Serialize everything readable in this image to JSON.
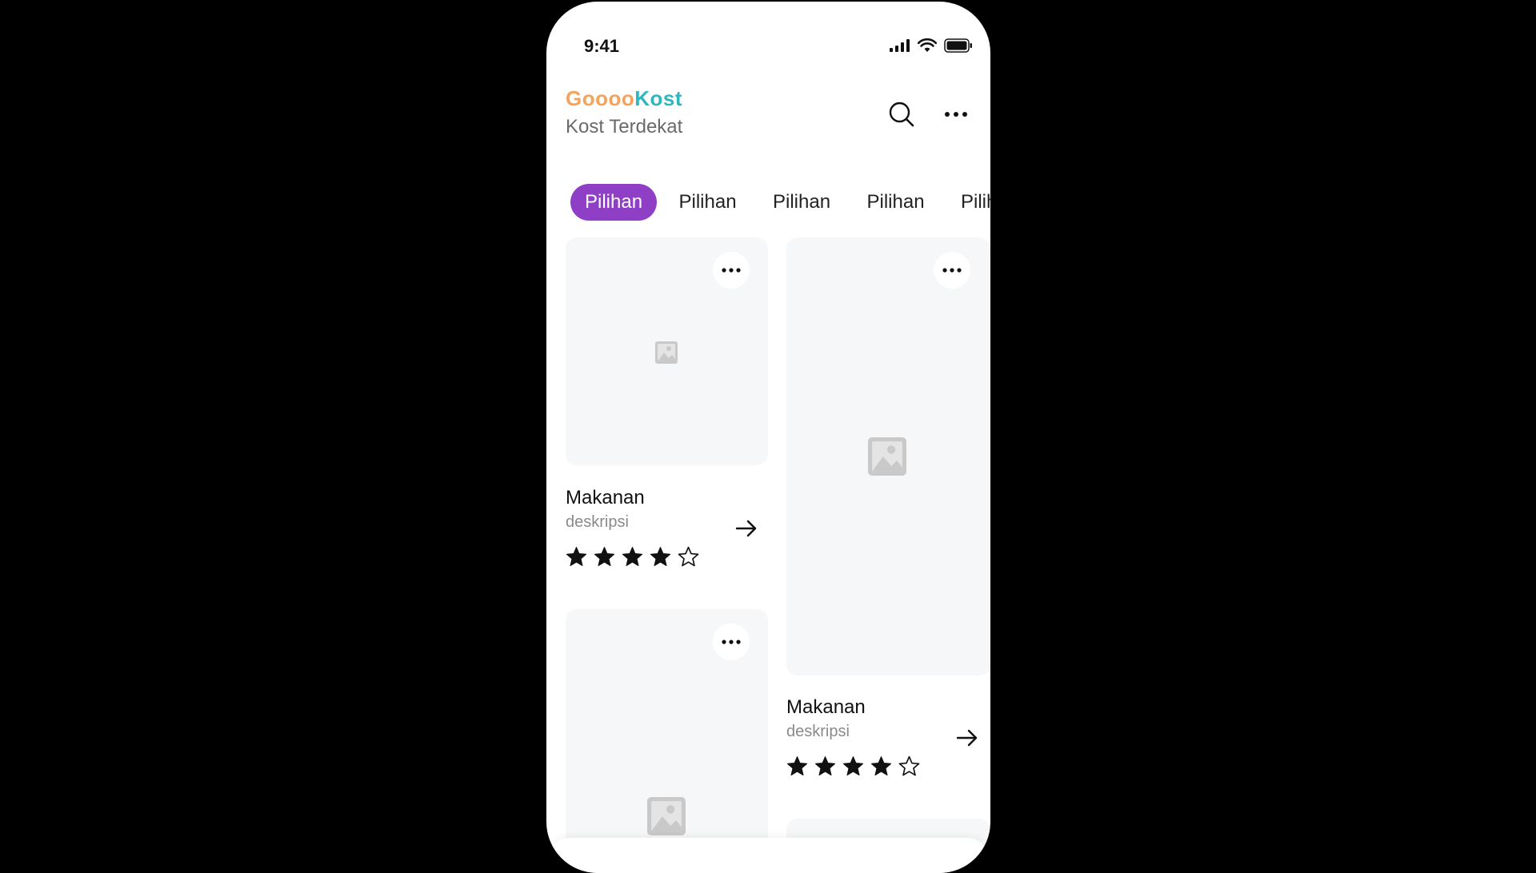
{
  "status_bar": {
    "time": "9:41"
  },
  "header": {
    "brand_part1": "Goooo",
    "brand_part2": "Kost",
    "subtitle": "Kost Terdekat",
    "search_icon": "search-icon",
    "more_icon": "more-horizontal-icon"
  },
  "chips": [
    {
      "label": "Pilihan",
      "active": true
    },
    {
      "label": "Pilihan",
      "active": false
    },
    {
      "label": "Pilihan",
      "active": false
    },
    {
      "label": "Pilihan",
      "active": false
    },
    {
      "label": "Pilihan",
      "active": false
    }
  ],
  "cards": [
    {
      "title": "Makanan",
      "description": "deskripsi",
      "rating": 4,
      "max_rating": 5
    },
    {
      "title": "Makanan",
      "description": "deskripsi",
      "rating": 4,
      "max_rating": 5
    },
    {
      "title": "",
      "description": "",
      "rating": 0,
      "max_rating": 5
    }
  ],
  "colors": {
    "brand_orange": "#f5a35c",
    "brand_teal": "#2fb6bf",
    "chip_active": "#8e3fc6",
    "placeholder_bg": "#f6f7f8"
  }
}
